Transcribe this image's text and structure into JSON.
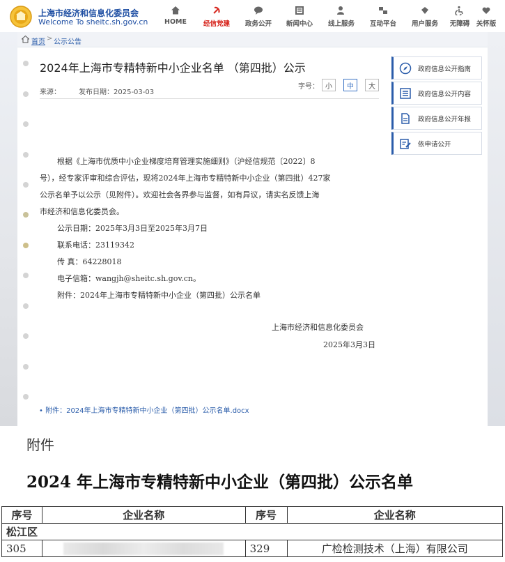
{
  "site": {
    "name_cn": "上海市经济和信息化委员会",
    "name_en": "Welcome To sheitc.sh.gov.cn"
  },
  "nav": [
    {
      "label": "HOME",
      "icon": "home-icon"
    },
    {
      "label": "经信党建",
      "icon": "party-icon",
      "active": true
    },
    {
      "label": "政务公开",
      "icon": "chat-icon"
    },
    {
      "label": "新闻中心",
      "icon": "news-icon"
    },
    {
      "label": "线上服务",
      "icon": "user-service-icon"
    },
    {
      "label": "互动平台",
      "icon": "interaction-icon"
    },
    {
      "label": "用户服务",
      "icon": "diamond-icon"
    },
    {
      "label": "无障碍",
      "icon": "accessibility-icon"
    },
    {
      "label": "关怀版",
      "icon": "care-icon"
    }
  ],
  "breadcrumb": {
    "home": "首页",
    "separator": ">",
    "current": "公示公告"
  },
  "article": {
    "title": "2024年上海市专精特新中小企业名单 （第四批）公示",
    "source_label": "来源：",
    "date_label": "发布日期：2025-03-03",
    "font_size_label": "字号：",
    "font_sizes": [
      "小",
      "中",
      "大"
    ],
    "paragraph_lines": [
      "根据《上海市优质中小企业梯度培育管理实施细则》（沪经信规范〔2022〕8",
      "号），经专家评审和综合评估，现将2024年上海市专精特新中小企业（第四批）427家",
      "公示名单予以公示（见附件）。欢迎社会各界参与监督，如有异议，请实名反馈上海",
      "市经济和信息化委员会。"
    ],
    "detail_lines": [
      "公示日期：2025年3月3日至2025年3月7日",
      "联系电话：23119342",
      "传  真：64228018",
      "电子信箱：wangjh@sheitc.sh.gov.cn。",
      "附件：2024年上海市专精特新中小企业（第四批）公示名单"
    ],
    "signature_org": "上海市经济和信息化委员会",
    "signature_date": "2025年3月3日",
    "attachment_link": "• 附件：2024年上海市专精特新中小企业（第四批）公示名单.docx"
  },
  "sidebar": [
    {
      "label": "政府信息公开指南",
      "icon": "compass-icon"
    },
    {
      "label": "政府信息公开内容",
      "icon": "list-icon"
    },
    {
      "label": "政府信息公开年报",
      "icon": "report-icon"
    },
    {
      "label": "依申请公开",
      "icon": "apply-icon"
    }
  ],
  "document": {
    "attachment_heading": "附件",
    "title": "2024 年上海市专精特新中小企业（第四批）公示名单",
    "headers": [
      "序号",
      "企业名称",
      "序号",
      "企业名称"
    ],
    "district": "松江区",
    "row": {
      "left_no": "305",
      "right_no": "329",
      "right_name": "广检检测技术（上海）有限公司"
    }
  },
  "colors": {
    "brand_blue": "#1f4fa3",
    "active_red": "#d7261e",
    "link_blue": "#2a5caa"
  }
}
